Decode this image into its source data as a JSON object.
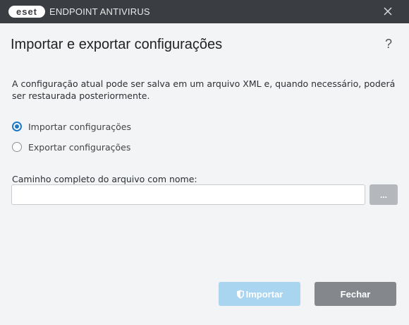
{
  "window": {
    "logo_text": "eset",
    "product_name": "ENDPOINT ANTIVIRUS"
  },
  "dialog": {
    "title": "Importar e exportar configurações",
    "help_label": "?",
    "description": "A configuração atual pode ser salva em um arquivo XML e, quando necessário, poderá ser restaurada posteriormente.",
    "options": [
      {
        "label": "Importar configurações",
        "checked": true
      },
      {
        "label": "Exportar configurações",
        "checked": false
      }
    ],
    "path_label": "Caminho completo do arquivo com nome:",
    "path_value": "",
    "browse_label": "...",
    "import_label": "Importar",
    "close_label": "Fechar"
  },
  "colors": {
    "titlebar": "#3a3d42",
    "background": "#f3f4f6",
    "accent": "#1d79c7",
    "import_button_disabled": "#a9d5f0",
    "close_button": "#84888d"
  },
  "icons": {
    "close": "close-icon",
    "shield": "shield-icon",
    "logo": "eset-logo"
  }
}
